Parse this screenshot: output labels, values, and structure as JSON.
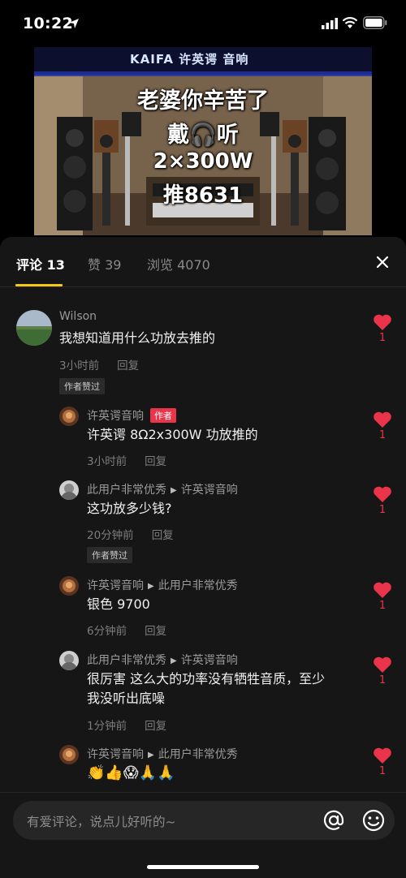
{
  "status_bar": {
    "time": "10:22"
  },
  "video": {
    "brand": "KAIFA 许英谔 音响",
    "overlay_lines": [
      "老婆你辛苦了",
      "戴🎧听",
      "2×300W",
      "推8631"
    ]
  },
  "tabs": {
    "comments": "评论 13",
    "likes": "赞 39",
    "views": "浏览 4070"
  },
  "comments": [
    {
      "user": "Wilson",
      "text": "我想知道用什么功放去推的",
      "time": "3小时前",
      "reply": "回复",
      "liked_tag": "作者赞过",
      "likes": "1"
    },
    {
      "user": "许英谔音响",
      "badge": "作者",
      "text": "许英谔 8Ω2x300W 功放推的",
      "time": "3小时前",
      "reply": "回复",
      "likes": "1"
    },
    {
      "user": "此用户非常优秀",
      "reply_to": "许英谔音响",
      "text": "这功放多少钱?",
      "time": "20分钟前",
      "reply": "回复",
      "liked_tag": "作者赞过",
      "likes": "1"
    },
    {
      "user": "许英谔音响",
      "reply_to": "此用户非常优秀",
      "text": "银色 9700",
      "time": "6分钟前",
      "reply": "回复",
      "likes": "1"
    },
    {
      "user": "此用户非常优秀",
      "reply_to": "许英谔音响",
      "text_line1": "很厉害 这么大的功率没有牺牲音质，至少",
      "text_line2": "我没听出底噪",
      "time": "1分钟前",
      "reply": "回复",
      "likes": "1"
    },
    {
      "user": "许英谔音响",
      "reply_to": "此用户非常优秀",
      "text": "👏👍😱🙏🙏",
      "likes": "1"
    }
  ],
  "input": {
    "placeholder": "有爱评论，说点儿好听的~"
  },
  "colors": {
    "accent_underline": "#f5c518",
    "heart": "#e9344a",
    "badge": "#e9344a",
    "panel_bg": "#161616"
  }
}
